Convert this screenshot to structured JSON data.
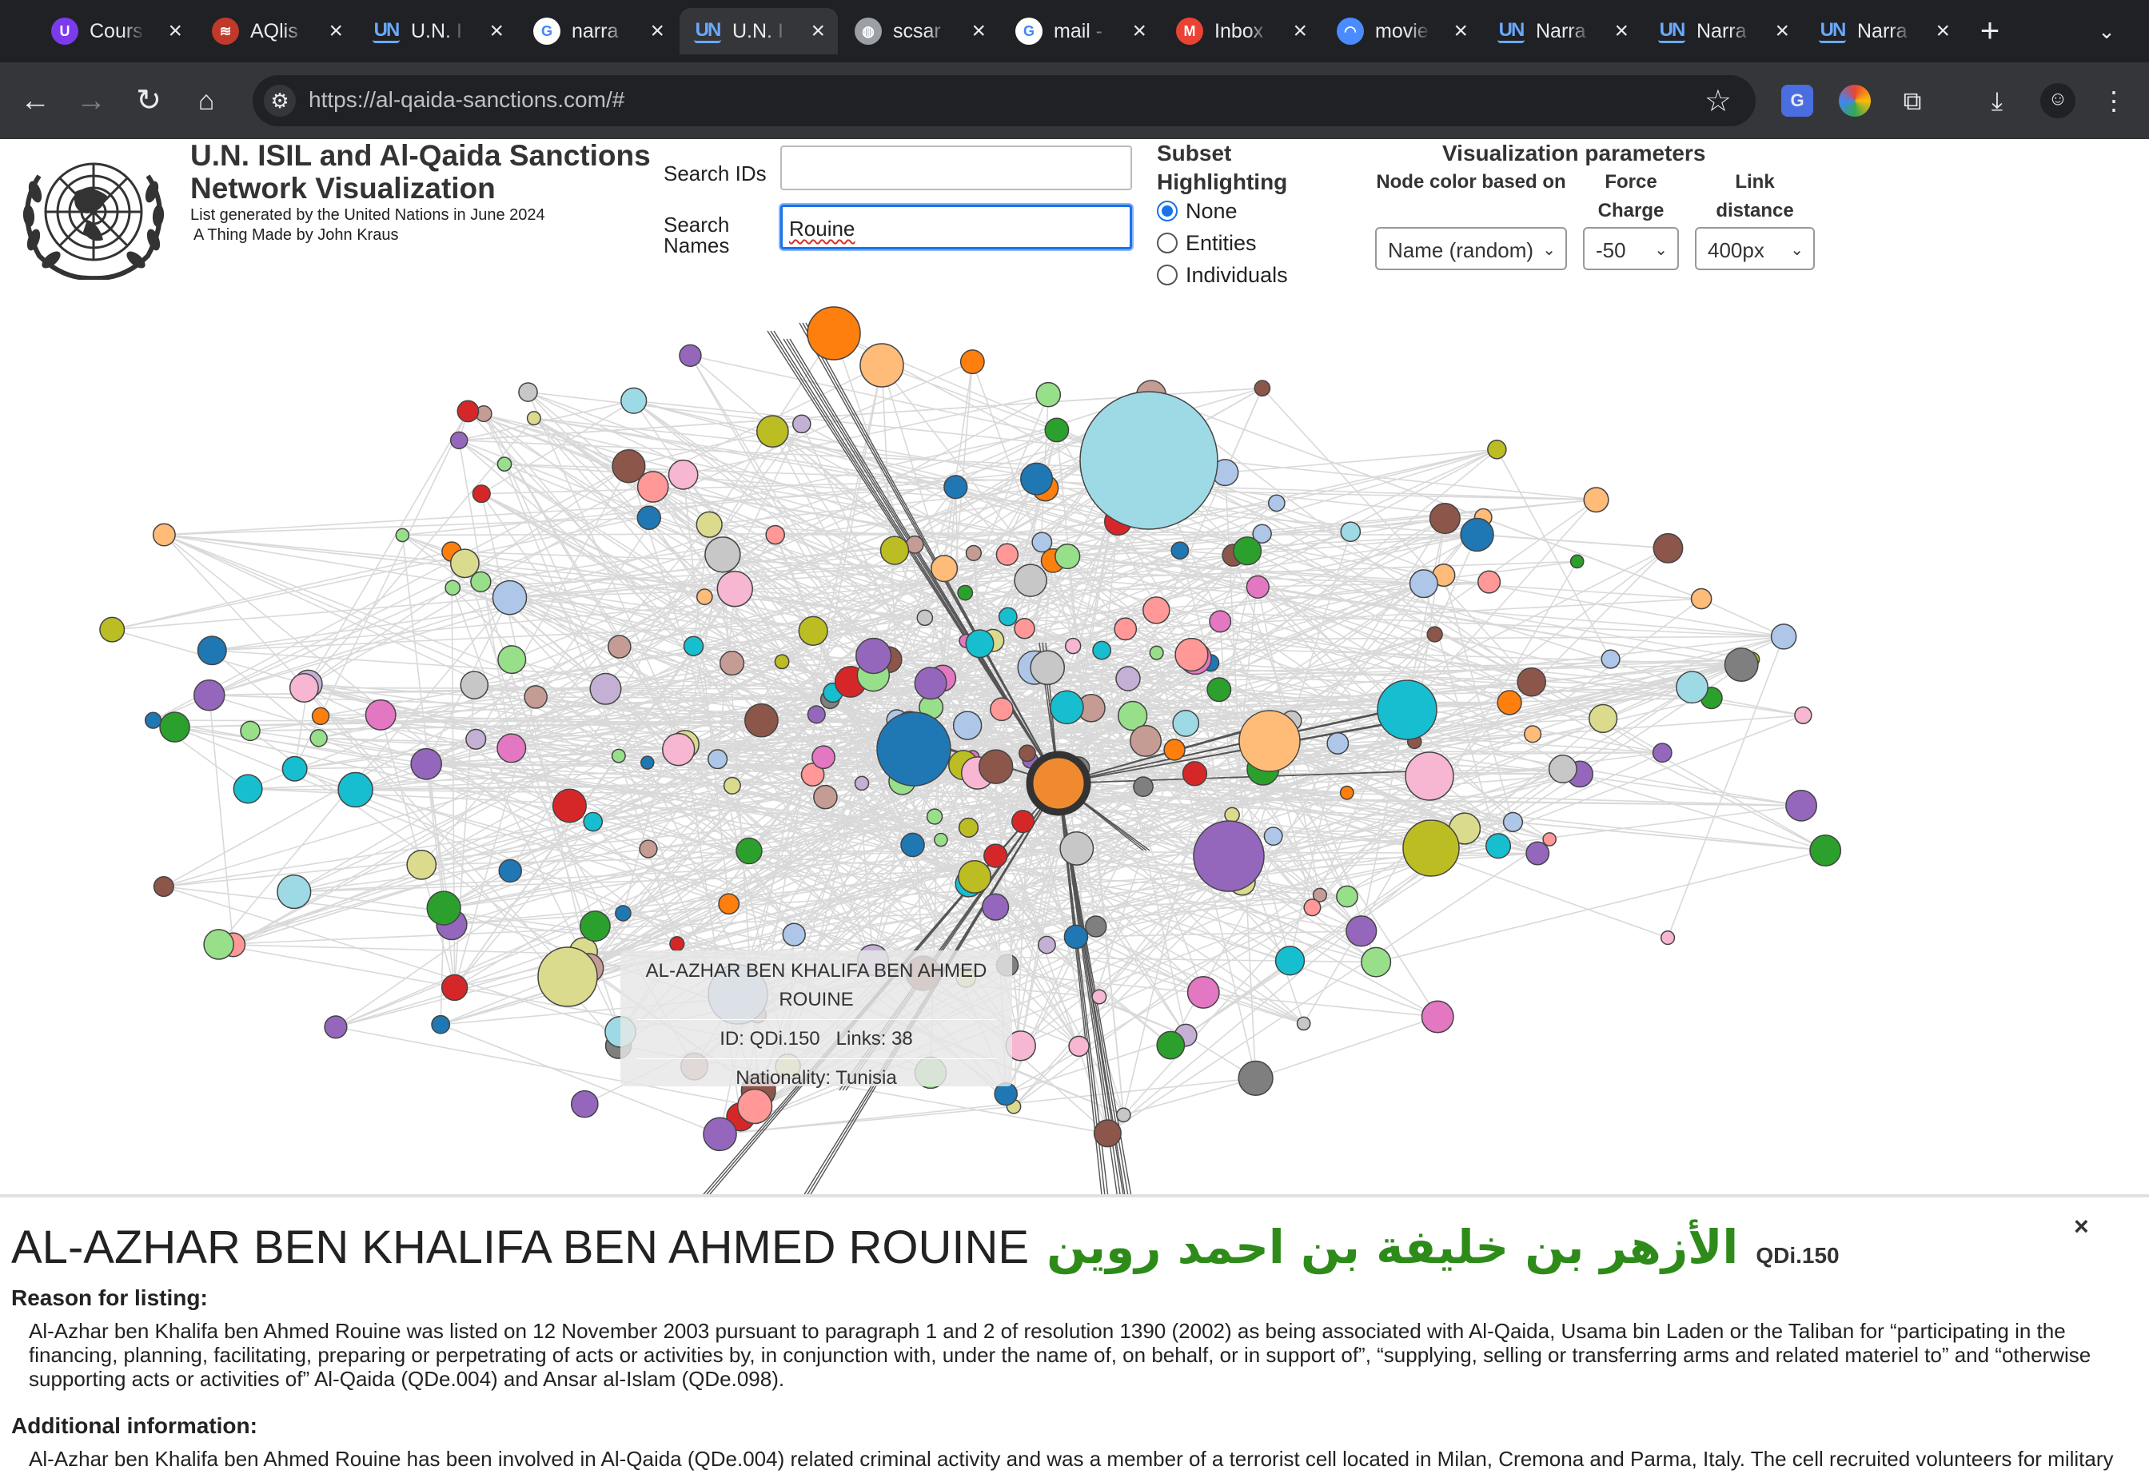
{
  "browser": {
    "tabs": [
      {
        "title": "Cours",
        "favicon": "U",
        "favicon_color": "#7c3aed"
      },
      {
        "title": "AQlis",
        "favicon": "≋",
        "favicon_color": "#c0392b"
      },
      {
        "title": "U.N. I",
        "favicon": "UN",
        "favicon_color": "#6aa9ff"
      },
      {
        "title": "narra",
        "favicon": "G",
        "favicon_color": "#ffffff"
      },
      {
        "title": "U.N. I",
        "favicon": "UN",
        "favicon_color": "#6aa9ff",
        "active": true
      },
      {
        "title": "scsar",
        "favicon": "◍",
        "favicon_color": "#9aa0a6"
      },
      {
        "title": "mail -",
        "favicon": "G",
        "favicon_color": "#ffffff"
      },
      {
        "title": "Inbox",
        "favicon": "M",
        "favicon_color": "#ea4335"
      },
      {
        "title": "movie",
        "favicon": "◠",
        "favicon_color": "#4a8cff"
      },
      {
        "title": "Narra",
        "favicon": "UN",
        "favicon_color": "#6aa9ff"
      },
      {
        "title": "Narra",
        "favicon": "UN",
        "favicon_color": "#6aa9ff"
      },
      {
        "title": "Narra",
        "favicon": "UN",
        "favicon_color": "#6aa9ff"
      }
    ],
    "url": "https://al-qaida-sanctions.com/#"
  },
  "header": {
    "title": "U.N. ISIL and Al-Qaida Sanctions Network Visualization",
    "subtitle": "List generated by the United Nations in June 2024",
    "credit": "A Thing Made by John Kraus"
  },
  "search": {
    "ids_label": "Search IDs",
    "ids_value": "",
    "names_label": "Search Names",
    "names_value": "Rouine"
  },
  "subset": {
    "title": "Subset Highlighting",
    "options": [
      "None",
      "Entities",
      "Individuals"
    ],
    "selected": "None"
  },
  "viz_params": {
    "title": "Visualization parameters",
    "node_color_label": "Node color based on",
    "node_color_value": "Name (random)",
    "force_label": "Force Charge",
    "force_value": "-50",
    "link_label": "Link distance",
    "link_value": "400px"
  },
  "tooltip": {
    "name": "AL-AZHAR BEN KHALIFA BEN AHMED ROUINE",
    "id_text": "ID: QDi.150",
    "links_text": "Links: 38",
    "nationality_text": "Nationality: Tunisia"
  },
  "details": {
    "name": "AL-AZHAR BEN KHALIFA BEN AHMED ROUINE",
    "name_arabic": "الأزهر بن خليفة بن احمد روين",
    "id": "QDi.150",
    "close": "×",
    "reason_heading": "Reason for listing:",
    "reason_text": "Al-Azhar ben Khalifa ben Ahmed Rouine was listed on 12 November 2003 pursuant to paragraph 1 and 2 of resolution 1390 (2002) as being associated with Al-Qaida, Usama bin Laden or the Taliban for “participating in the financing, planning, facilitating, preparing or perpetrating of acts or activities by, in conjunction with, under the name of, on behalf, or in support of”, “supplying, selling or transferring arms and related materiel to” and “otherwise supporting acts or activities of” Al-Qaida (QDe.004) and Ansar al-Islam (QDe.098).",
    "additional_heading": "Additional information:",
    "additional_text": "Al-Azhar ben Khalifa ben Ahmed Rouine has been involved in Al-Qaida (QDe.004) related criminal activity and was a member of a terrorist cell located in Milan, Cremona and Parma, Italy. The cell recruited volunteers for military"
  },
  "colors": {
    "accent": "#1a73e8",
    "arabic_name": "#2e8b1a",
    "highlight_node": "#f08a30"
  }
}
